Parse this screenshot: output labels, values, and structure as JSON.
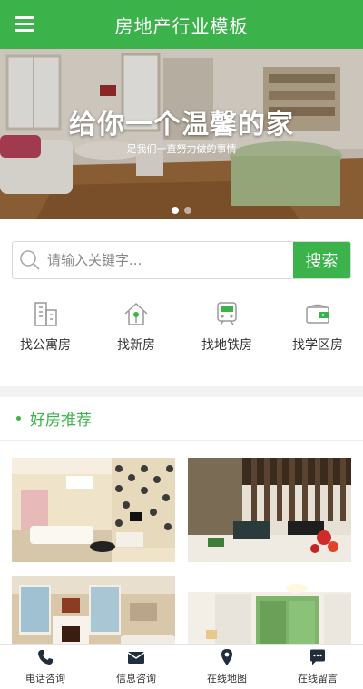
{
  "header": {
    "title": "房地产行业模板"
  },
  "banner": {
    "title": "给你一个温馨的家",
    "subtitle": "足我们一直努力做的事情"
  },
  "search": {
    "placeholder": "请输入关键字...",
    "button_label": "搜索"
  },
  "quick_nav": [
    {
      "label": "找公寓房",
      "icon": "apartment-building-icon"
    },
    {
      "label": "找新房",
      "icon": "new-house-icon"
    },
    {
      "label": "找地铁房",
      "icon": "subway-train-icon"
    },
    {
      "label": "找学区房",
      "icon": "school-district-icon"
    }
  ],
  "section": {
    "title": "好房推荐"
  },
  "bottom_nav": [
    {
      "label": "电话咨询",
      "icon": "phone-icon"
    },
    {
      "label": "信息咨询",
      "icon": "envelope-icon"
    },
    {
      "label": "在线地图",
      "icon": "map-pin-icon"
    },
    {
      "label": "在线留言",
      "icon": "chat-bubble-icon"
    }
  ],
  "colors": {
    "accent": "#3bb24a",
    "text": "#333333",
    "icon_gray": "#999999"
  }
}
